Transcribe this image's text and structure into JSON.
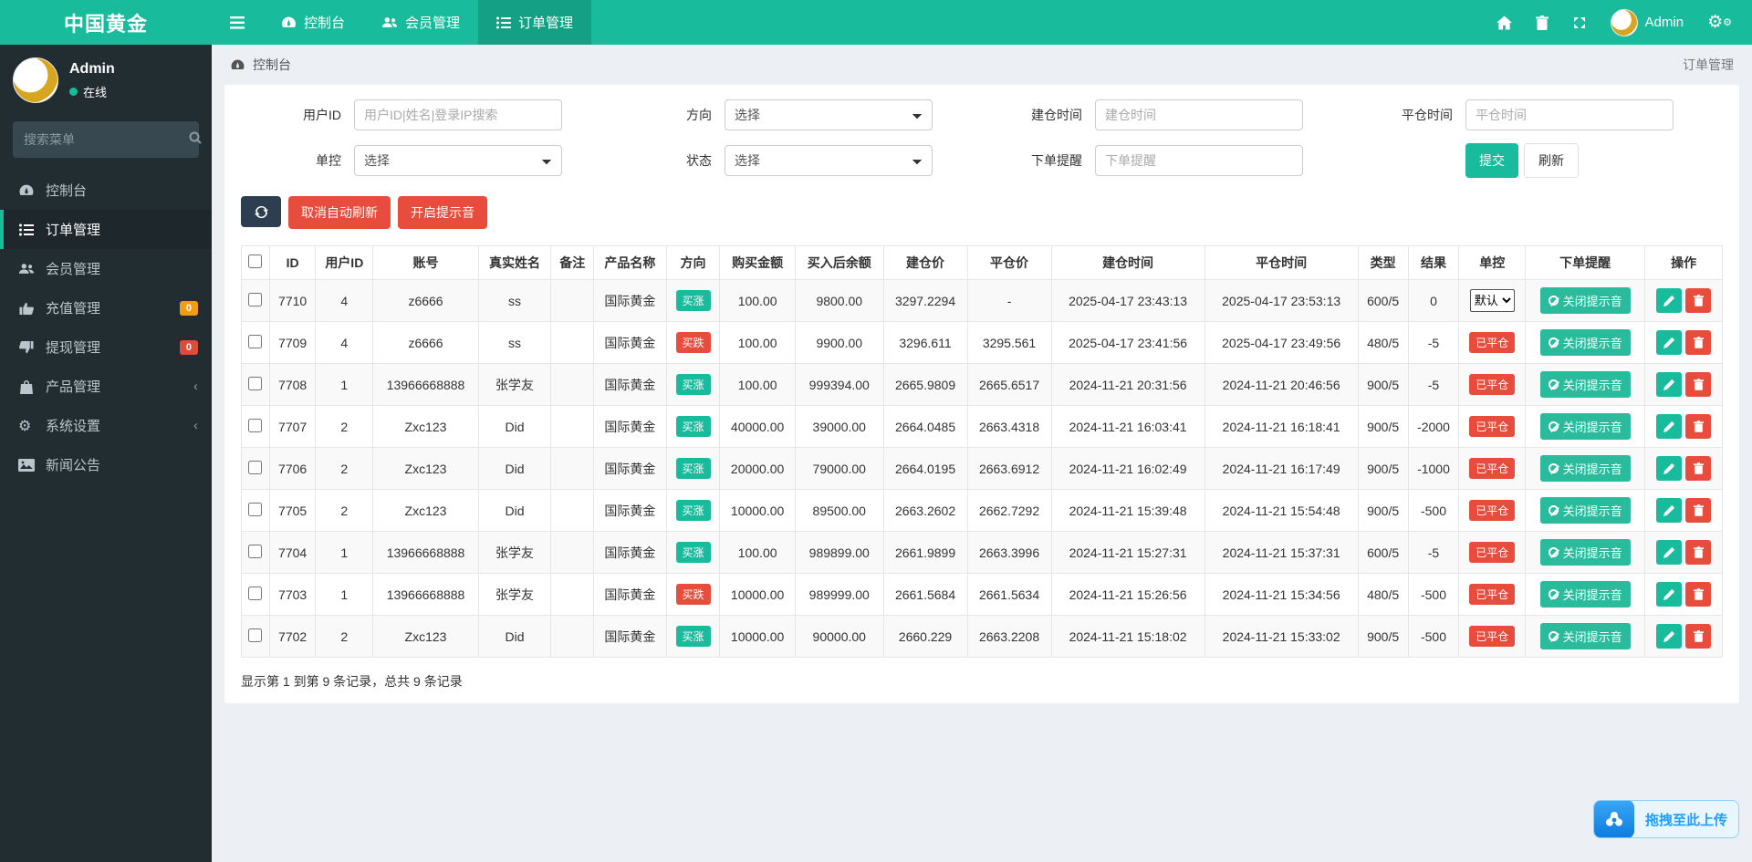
{
  "navbar": {
    "brand": "中国黄金",
    "items": [
      {
        "label": "控制台"
      },
      {
        "label": "会员管理"
      },
      {
        "label": "订单管理",
        "active": true
      }
    ],
    "user": "Admin"
  },
  "sidebar": {
    "user": {
      "name": "Admin",
      "status": "在线"
    },
    "search_placeholder": "搜索菜单",
    "items": [
      {
        "label": "控制台"
      },
      {
        "label": "订单管理"
      },
      {
        "label": "会员管理"
      },
      {
        "label": "充值管理",
        "badge": "0"
      },
      {
        "label": "提现管理",
        "badge": "0"
      },
      {
        "label": "产品管理"
      },
      {
        "label": "系统设置"
      },
      {
        "label": "新闻公告"
      }
    ]
  },
  "breadcrumb": {
    "left": "控制台",
    "right": "订单管理"
  },
  "filters": {
    "user_id_label": "用户ID",
    "user_id_placeholder": "用户ID|姓名|登录IP搜索",
    "direction_label": "方向",
    "direction_value": "选择",
    "open_time_label": "建仓时间",
    "open_time_placeholder": "建仓时间",
    "close_time_label": "平仓时间",
    "close_time_placeholder": "平仓时间",
    "control_label": "单控",
    "control_value": "选择",
    "status_label": "状态",
    "status_value": "选择",
    "remind_label": "下单提醒",
    "remind_placeholder": "下单提醒",
    "submit_label": "提交",
    "refresh_label": "刷新"
  },
  "toolbar": {
    "cancel_auto_refresh": "取消自动刷新",
    "enable_sound": "开启提示音"
  },
  "table": {
    "headers": [
      "ID",
      "用户ID",
      "账号",
      "真实姓名",
      "备注",
      "产品名称",
      "方向",
      "购买金额",
      "买入后余额",
      "建仓价",
      "平仓价",
      "建仓时间",
      "平仓时间",
      "类型",
      "结果",
      "单控",
      "下单提醒",
      "操作"
    ],
    "close_sound_label": "关闭提示音",
    "closed_label": "已平仓",
    "control_default": "默认",
    "direction_up_label": "买涨",
    "direction_down_label": "买跌",
    "rows": [
      {
        "id": "7710",
        "user_id": "4",
        "account": "z6666",
        "real_name": "ss",
        "remark": "",
        "product": "国际黄金",
        "direction": "up",
        "amount": "100.00",
        "balance_after": "9800.00",
        "open_price": "3297.2294",
        "close_price": "-",
        "open_time": "2025-04-17 23:43:13",
        "close_time": "2025-04-17 23:53:13",
        "type": "600/5",
        "result": "0",
        "control": "select"
      },
      {
        "id": "7709",
        "user_id": "4",
        "account": "z6666",
        "real_name": "ss",
        "remark": "",
        "product": "国际黄金",
        "direction": "down",
        "amount": "100.00",
        "balance_after": "9900.00",
        "open_price": "3296.611",
        "close_price": "3295.561",
        "open_time": "2025-04-17 23:41:56",
        "close_time": "2025-04-17 23:49:56",
        "type": "480/5",
        "result": "-5",
        "control": "closed"
      },
      {
        "id": "7708",
        "user_id": "1",
        "account": "13966668888",
        "real_name": "张学友",
        "remark": "",
        "product": "国际黄金",
        "direction": "up",
        "amount": "100.00",
        "balance_after": "999394.00",
        "open_price": "2665.9809",
        "close_price": "2665.6517",
        "open_time": "2024-11-21 20:31:56",
        "close_time": "2024-11-21 20:46:56",
        "type": "900/5",
        "result": "-5",
        "control": "closed"
      },
      {
        "id": "7707",
        "user_id": "2",
        "account": "Zxc123",
        "real_name": "Did",
        "remark": "",
        "product": "国际黄金",
        "direction": "up",
        "amount": "40000.00",
        "balance_after": "39000.00",
        "open_price": "2664.0485",
        "close_price": "2663.4318",
        "open_time": "2024-11-21 16:03:41",
        "close_time": "2024-11-21 16:18:41",
        "type": "900/5",
        "result": "-2000",
        "control": "closed"
      },
      {
        "id": "7706",
        "user_id": "2",
        "account": "Zxc123",
        "real_name": "Did",
        "remark": "",
        "product": "国际黄金",
        "direction": "up",
        "amount": "20000.00",
        "balance_after": "79000.00",
        "open_price": "2664.0195",
        "close_price": "2663.6912",
        "open_time": "2024-11-21 16:02:49",
        "close_time": "2024-11-21 16:17:49",
        "type": "900/5",
        "result": "-1000",
        "control": "closed"
      },
      {
        "id": "7705",
        "user_id": "2",
        "account": "Zxc123",
        "real_name": "Did",
        "remark": "",
        "product": "国际黄金",
        "direction": "up",
        "amount": "10000.00",
        "balance_after": "89500.00",
        "open_price": "2663.2602",
        "close_price": "2662.7292",
        "open_time": "2024-11-21 15:39:48",
        "close_time": "2024-11-21 15:54:48",
        "type": "900/5",
        "result": "-500",
        "control": "closed"
      },
      {
        "id": "7704",
        "user_id": "1",
        "account": "13966668888",
        "real_name": "张学友",
        "remark": "",
        "product": "国际黄金",
        "direction": "up",
        "amount": "100.00",
        "balance_after": "989899.00",
        "open_price": "2661.9899",
        "close_price": "2663.3996",
        "open_time": "2024-11-21 15:27:31",
        "close_time": "2024-11-21 15:37:31",
        "type": "600/5",
        "result": "-5",
        "control": "closed"
      },
      {
        "id": "7703",
        "user_id": "1",
        "account": "13966668888",
        "real_name": "张学友",
        "remark": "",
        "product": "国际黄金",
        "direction": "down",
        "amount": "10000.00",
        "balance_after": "989999.00",
        "open_price": "2661.5684",
        "close_price": "2661.5634",
        "open_time": "2024-11-21 15:26:56",
        "close_time": "2024-11-21 15:34:56",
        "type": "480/5",
        "result": "-500",
        "control": "closed"
      },
      {
        "id": "7702",
        "user_id": "2",
        "account": "Zxc123",
        "real_name": "Did",
        "remark": "",
        "product": "国际黄金",
        "direction": "up",
        "amount": "10000.00",
        "balance_after": "90000.00",
        "open_price": "2660.229",
        "close_price": "2663.2208",
        "open_time": "2024-11-21 15:18:02",
        "close_time": "2024-11-21 15:33:02",
        "type": "900/5",
        "result": "-500",
        "control": "closed"
      }
    ]
  },
  "footer": {
    "summary": "显示第 1 到第 9 条记录，总共 9 条记录"
  },
  "upload_widget": {
    "label": "拖拽至此上传"
  },
  "colors": {
    "primary": "#18bc9c",
    "danger": "#e74c3c",
    "navy": "#2c3e50",
    "orange_badge": "#f39c12",
    "red_badge": "#dd4b39",
    "sidebar_bg": "#222d32",
    "content_bg": "#ecf0f5",
    "upload_blue": "#1e9fff"
  }
}
